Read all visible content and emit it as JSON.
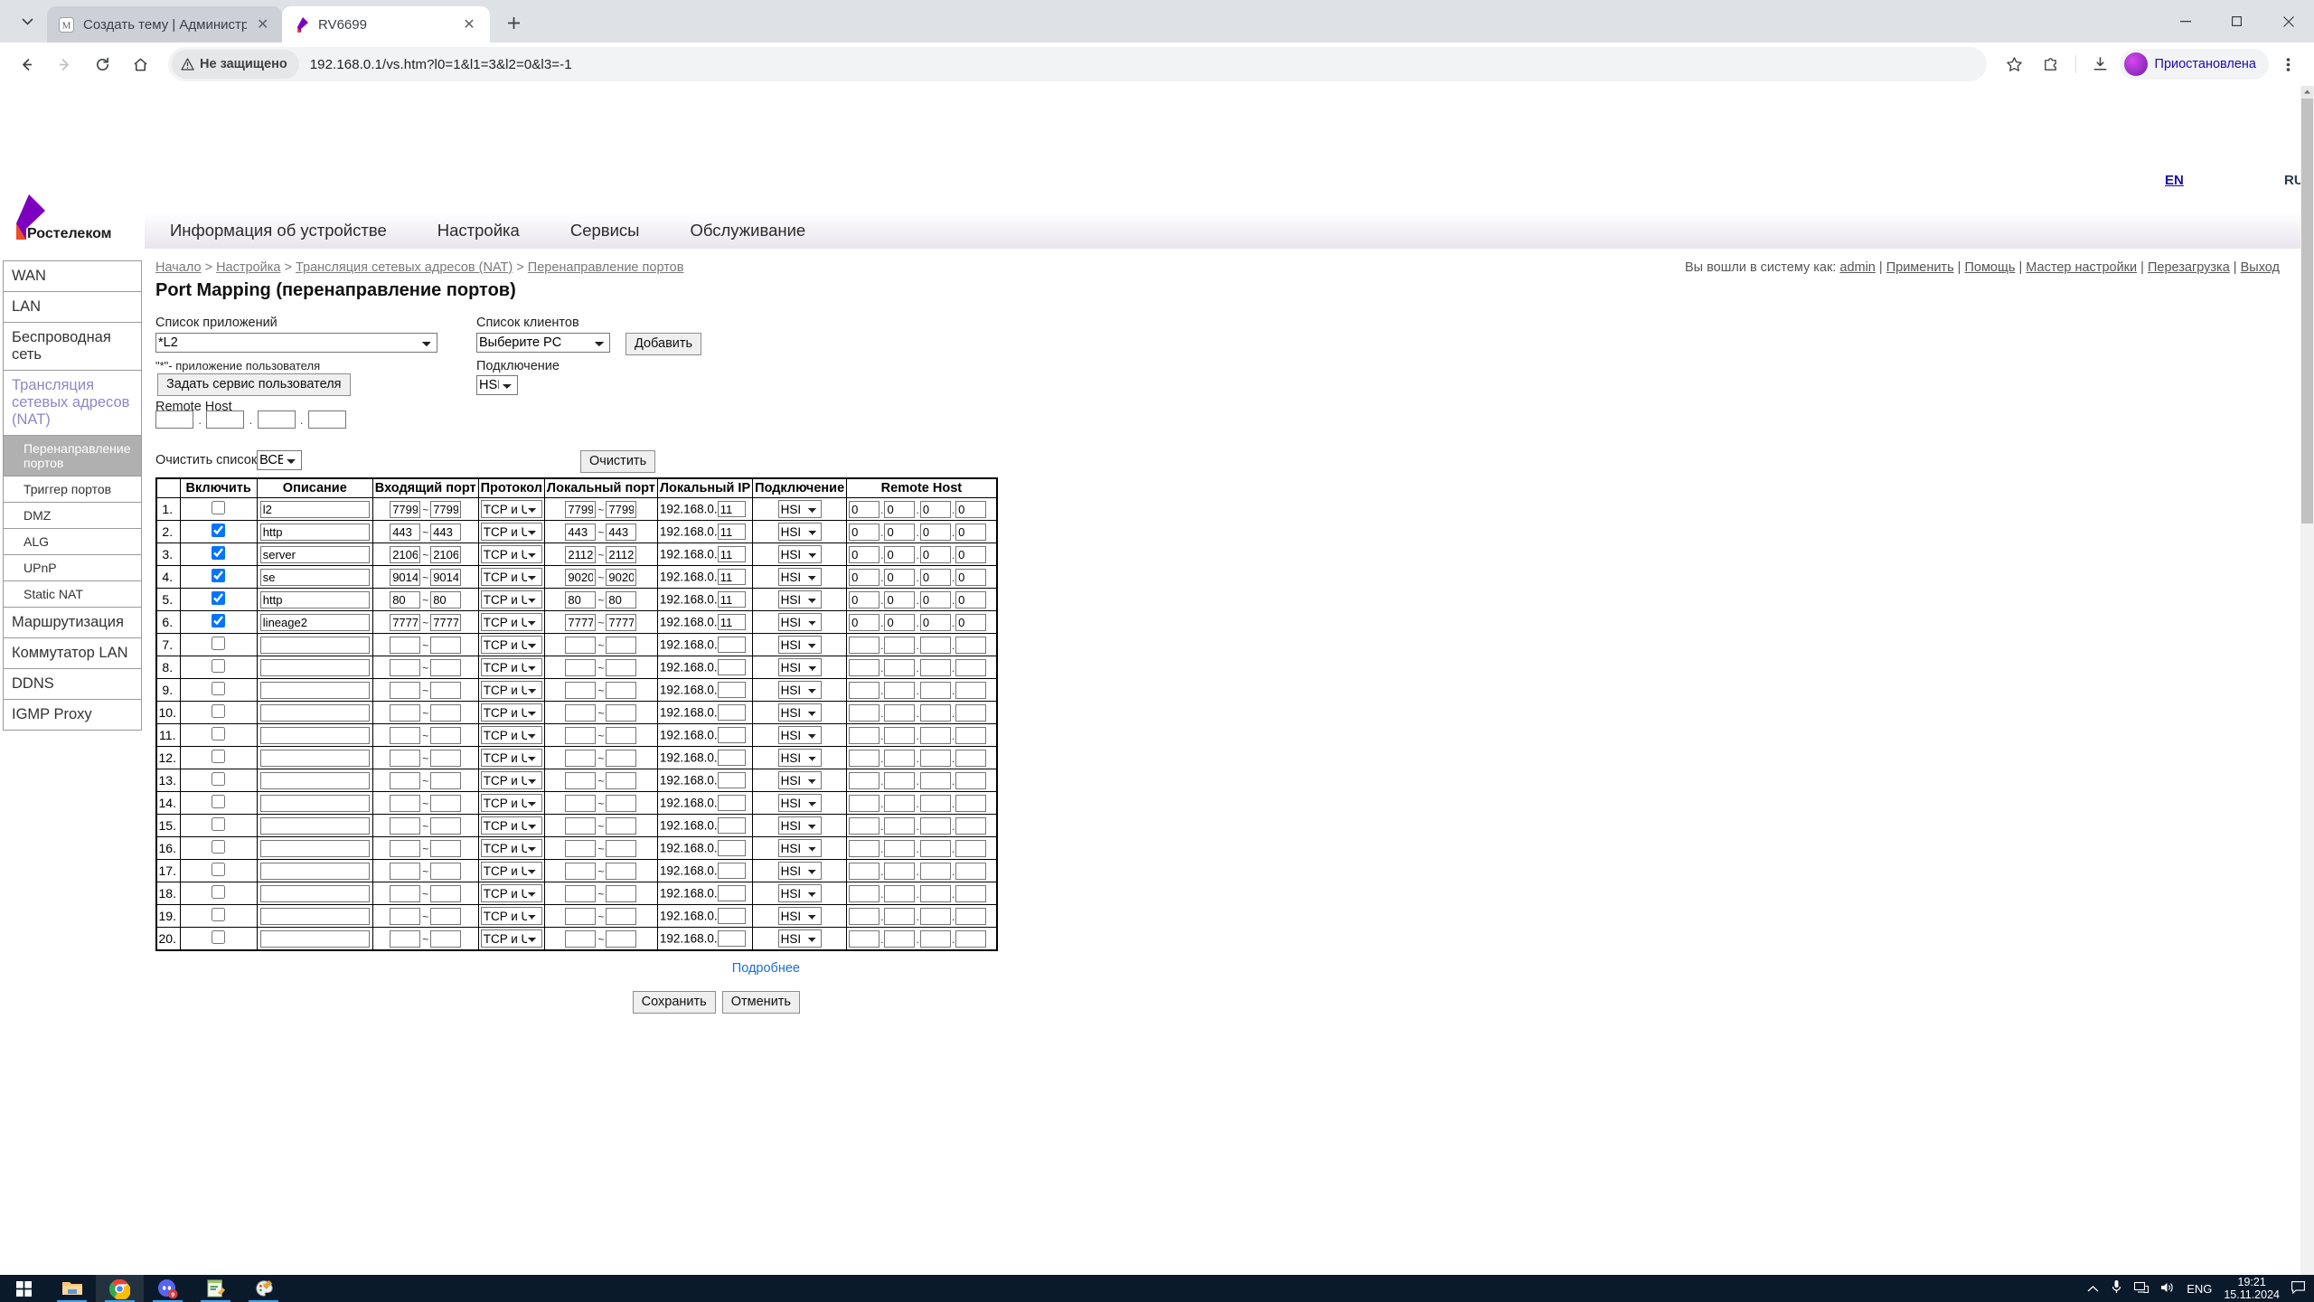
{
  "browser": {
    "tabs": [
      {
        "title": "Создать тему | Администратор",
        "favicon": "m-logo-icon",
        "active": false
      },
      {
        "title": "RV6699",
        "favicon": "rostelecom-icon",
        "active": true
      }
    ],
    "new_tab_label": "+",
    "security_label": "Не защищено",
    "url": "192.168.0.1/vs.htm?l0=1&l1=3&l2=0&l3=-1",
    "profile_label": "Приостановлена",
    "window_buttons": {
      "minimize": "—",
      "maximize": "▢",
      "close": "✕"
    }
  },
  "page": {
    "lang": {
      "en": "EN",
      "ru": "RU"
    },
    "logo_text": "Ростелеком",
    "nav": [
      "Информация об устройстве",
      "Настройка",
      "Сервисы",
      "Обслуживание"
    ],
    "breadcrumb": [
      "Начало",
      "Настройка",
      "Трансляция сетевых адресов (NAT)",
      "Перенаправление портов"
    ],
    "login_info": {
      "prefix": "Вы вошли в систему как:",
      "user": "admin",
      "links": [
        "Применить",
        "Помощь",
        "Мастер настройки",
        "Перезагрузка",
        "Выход"
      ]
    },
    "title": "Port Mapping (перенаправление портов)",
    "sidebar": [
      {
        "label": "WAN",
        "level": 1,
        "state": "normal"
      },
      {
        "label": "LAN",
        "level": 1,
        "state": "normal"
      },
      {
        "label": "Беспроводная сеть",
        "level": 1,
        "state": "normal"
      },
      {
        "label": "Трансляция сетевых адресов (NAT)",
        "level": 1,
        "state": "open"
      },
      {
        "label": "Перенаправление портов",
        "level": 2,
        "state": "selected"
      },
      {
        "label": "Триггер портов",
        "level": 2,
        "state": "normal"
      },
      {
        "label": "DMZ",
        "level": 2,
        "state": "normal"
      },
      {
        "label": "ALG",
        "level": 2,
        "state": "normal"
      },
      {
        "label": "UPnP",
        "level": 2,
        "state": "normal"
      },
      {
        "label": "Static NAT",
        "level": 2,
        "state": "normal"
      },
      {
        "label": "Маршрутизация",
        "level": 1,
        "state": "normal"
      },
      {
        "label": "Коммутатор LAN",
        "level": 1,
        "state": "normal"
      },
      {
        "label": "DDNS",
        "level": 1,
        "state": "normal"
      },
      {
        "label": "IGMP Proxy",
        "level": 1,
        "state": "normal"
      }
    ],
    "form": {
      "app_list_label": "Список приложений",
      "app_list_value": "*L2",
      "client_list_label": "Список клиентов",
      "client_list_value": "Выберите PC",
      "add_button": "Добавить",
      "user_app_note": "\"*\"- приложение пользователя",
      "user_service_button": "Задать сервис пользователя",
      "connection_label": "Подключение",
      "connection_value": "HSI",
      "remote_host_label": "Remote Host",
      "remote_host_octets": [
        "",
        "",
        "",
        ""
      ],
      "clear_list_label": "Очистить список",
      "clear_list_value": "ВСЕ",
      "clear_button": "Очистить"
    },
    "table": {
      "headers": [
        "",
        "Включить",
        "Описание",
        "Входящий порт",
        "Протокол",
        "Локальный порт",
        "Локальный IP",
        "Подключение",
        "Remote Host"
      ],
      "ip_prefix": "192.168.0.",
      "protocol_default": "TCP и UDP",
      "connection_default": "HSI",
      "rows": [
        {
          "idx": "1.",
          "enabled": false,
          "desc": "l2",
          "in_from": "7799",
          "in_to": "7799",
          "proto": "TCP и UDP",
          "lp_from": "7799",
          "lp_to": "7799",
          "lip": "11",
          "conn": "HSI",
          "rh": [
            "0",
            "0",
            "0",
            "0"
          ]
        },
        {
          "idx": "2.",
          "enabled": true,
          "desc": "http",
          "in_from": "443",
          "in_to": "443",
          "proto": "TCP и UDP",
          "lp_from": "443",
          "lp_to": "443",
          "lip": "11",
          "conn": "HSI",
          "rh": [
            "0",
            "0",
            "0",
            "0"
          ]
        },
        {
          "idx": "3.",
          "enabled": true,
          "desc": "server",
          "in_from": "2106",
          "in_to": "2106",
          "proto": "TCP и UDP",
          "lp_from": "2112",
          "lp_to": "2112",
          "lip": "11",
          "conn": "HSI",
          "rh": [
            "0",
            "0",
            "0",
            "0"
          ]
        },
        {
          "idx": "4.",
          "enabled": true,
          "desc": "se",
          "in_from": "9014",
          "in_to": "9014",
          "proto": "TCP и UDP",
          "lp_from": "9020",
          "lp_to": "9020",
          "lip": "11",
          "conn": "HSI",
          "rh": [
            "0",
            "0",
            "0",
            "0"
          ]
        },
        {
          "idx": "5.",
          "enabled": true,
          "desc": "http",
          "in_from": "80",
          "in_to": "80",
          "proto": "TCP и UDP",
          "lp_from": "80",
          "lp_to": "80",
          "lip": "11",
          "conn": "HSI",
          "rh": [
            "0",
            "0",
            "0",
            "0"
          ]
        },
        {
          "idx": "6.",
          "enabled": true,
          "desc": "lineage2",
          "in_from": "7777",
          "in_to": "7777",
          "proto": "TCP и UDP",
          "lp_from": "7777",
          "lp_to": "7777",
          "lip": "11",
          "conn": "HSI",
          "rh": [
            "0",
            "0",
            "0",
            "0"
          ]
        },
        {
          "idx": "7.",
          "enabled": false,
          "desc": "",
          "in_from": "",
          "in_to": "",
          "proto": "TCP и UDP",
          "lp_from": "",
          "lp_to": "",
          "lip": "",
          "conn": "HSI",
          "rh": [
            "",
            "",
            "",
            ""
          ]
        },
        {
          "idx": "8.",
          "enabled": false,
          "desc": "",
          "in_from": "",
          "in_to": "",
          "proto": "TCP и UDP",
          "lp_from": "",
          "lp_to": "",
          "lip": "",
          "conn": "HSI",
          "rh": [
            "",
            "",
            "",
            ""
          ]
        },
        {
          "idx": "9.",
          "enabled": false,
          "desc": "",
          "in_from": "",
          "in_to": "",
          "proto": "TCP и UDP",
          "lp_from": "",
          "lp_to": "",
          "lip": "",
          "conn": "HSI",
          "rh": [
            "",
            "",
            "",
            ""
          ]
        },
        {
          "idx": "10.",
          "enabled": false,
          "desc": "",
          "in_from": "",
          "in_to": "",
          "proto": "TCP и UDP",
          "lp_from": "",
          "lp_to": "",
          "lip": "",
          "conn": "HSI",
          "rh": [
            "",
            "",
            "",
            ""
          ]
        },
        {
          "idx": "11.",
          "enabled": false,
          "desc": "",
          "in_from": "",
          "in_to": "",
          "proto": "TCP и UDP",
          "lp_from": "",
          "lp_to": "",
          "lip": "",
          "conn": "HSI",
          "rh": [
            "",
            "",
            "",
            ""
          ]
        },
        {
          "idx": "12.",
          "enabled": false,
          "desc": "",
          "in_from": "",
          "in_to": "",
          "proto": "TCP и UDP",
          "lp_from": "",
          "lp_to": "",
          "lip": "",
          "conn": "HSI",
          "rh": [
            "",
            "",
            "",
            ""
          ]
        },
        {
          "idx": "13.",
          "enabled": false,
          "desc": "",
          "in_from": "",
          "in_to": "",
          "proto": "TCP и UDP",
          "lp_from": "",
          "lp_to": "",
          "lip": "",
          "conn": "HSI",
          "rh": [
            "",
            "",
            "",
            ""
          ]
        },
        {
          "idx": "14.",
          "enabled": false,
          "desc": "",
          "in_from": "",
          "in_to": "",
          "proto": "TCP и UDP",
          "lp_from": "",
          "lp_to": "",
          "lip": "",
          "conn": "HSI",
          "rh": [
            "",
            "",
            "",
            ""
          ]
        },
        {
          "idx": "15.",
          "enabled": false,
          "desc": "",
          "in_from": "",
          "in_to": "",
          "proto": "TCP и UDP",
          "lp_from": "",
          "lp_to": "",
          "lip": "",
          "conn": "HSI",
          "rh": [
            "",
            "",
            "",
            ""
          ]
        },
        {
          "idx": "16.",
          "enabled": false,
          "desc": "",
          "in_from": "",
          "in_to": "",
          "proto": "TCP и UDP",
          "lp_from": "",
          "lp_to": "",
          "lip": "",
          "conn": "HSI",
          "rh": [
            "",
            "",
            "",
            ""
          ]
        },
        {
          "idx": "17.",
          "enabled": false,
          "desc": "",
          "in_from": "",
          "in_to": "",
          "proto": "TCP и UDP",
          "lp_from": "",
          "lp_to": "",
          "lip": "",
          "conn": "HSI",
          "rh": [
            "",
            "",
            "",
            ""
          ]
        },
        {
          "idx": "18.",
          "enabled": false,
          "desc": "",
          "in_from": "",
          "in_to": "",
          "proto": "TCP и UDP",
          "lp_from": "",
          "lp_to": "",
          "lip": "",
          "conn": "HSI",
          "rh": [
            "",
            "",
            "",
            ""
          ]
        },
        {
          "idx": "19.",
          "enabled": false,
          "desc": "",
          "in_from": "",
          "in_to": "",
          "proto": "TCP и UDP",
          "lp_from": "",
          "lp_to": "",
          "lip": "",
          "conn": "HSI",
          "rh": [
            "",
            "",
            "",
            ""
          ]
        },
        {
          "idx": "20.",
          "enabled": false,
          "desc": "",
          "in_from": "",
          "in_to": "",
          "proto": "TCP и UDP",
          "lp_from": "",
          "lp_to": "",
          "lip": "",
          "conn": "HSI",
          "rh": [
            "",
            "",
            "",
            ""
          ]
        }
      ]
    },
    "footer": {
      "more_link": "Подробнее",
      "save_button": "Сохранить",
      "cancel_button": "Отменить"
    }
  },
  "taskbar": {
    "apps": [
      "start-icon",
      "file-explorer-icon",
      "chrome-icon",
      "discord-icon",
      "notepad-icon",
      "paint-icon"
    ],
    "discord_badge": "9",
    "language": "ENG",
    "time": "19:21",
    "date": "15.11.2024"
  },
  "colors": {
    "accent_purple": "#7c00bf",
    "accent_orange": "#ee4e24",
    "link_blue": "#1a6fd4",
    "selected_gray": "#b0b0b0",
    "taskbar": "#0b1a2b"
  }
}
